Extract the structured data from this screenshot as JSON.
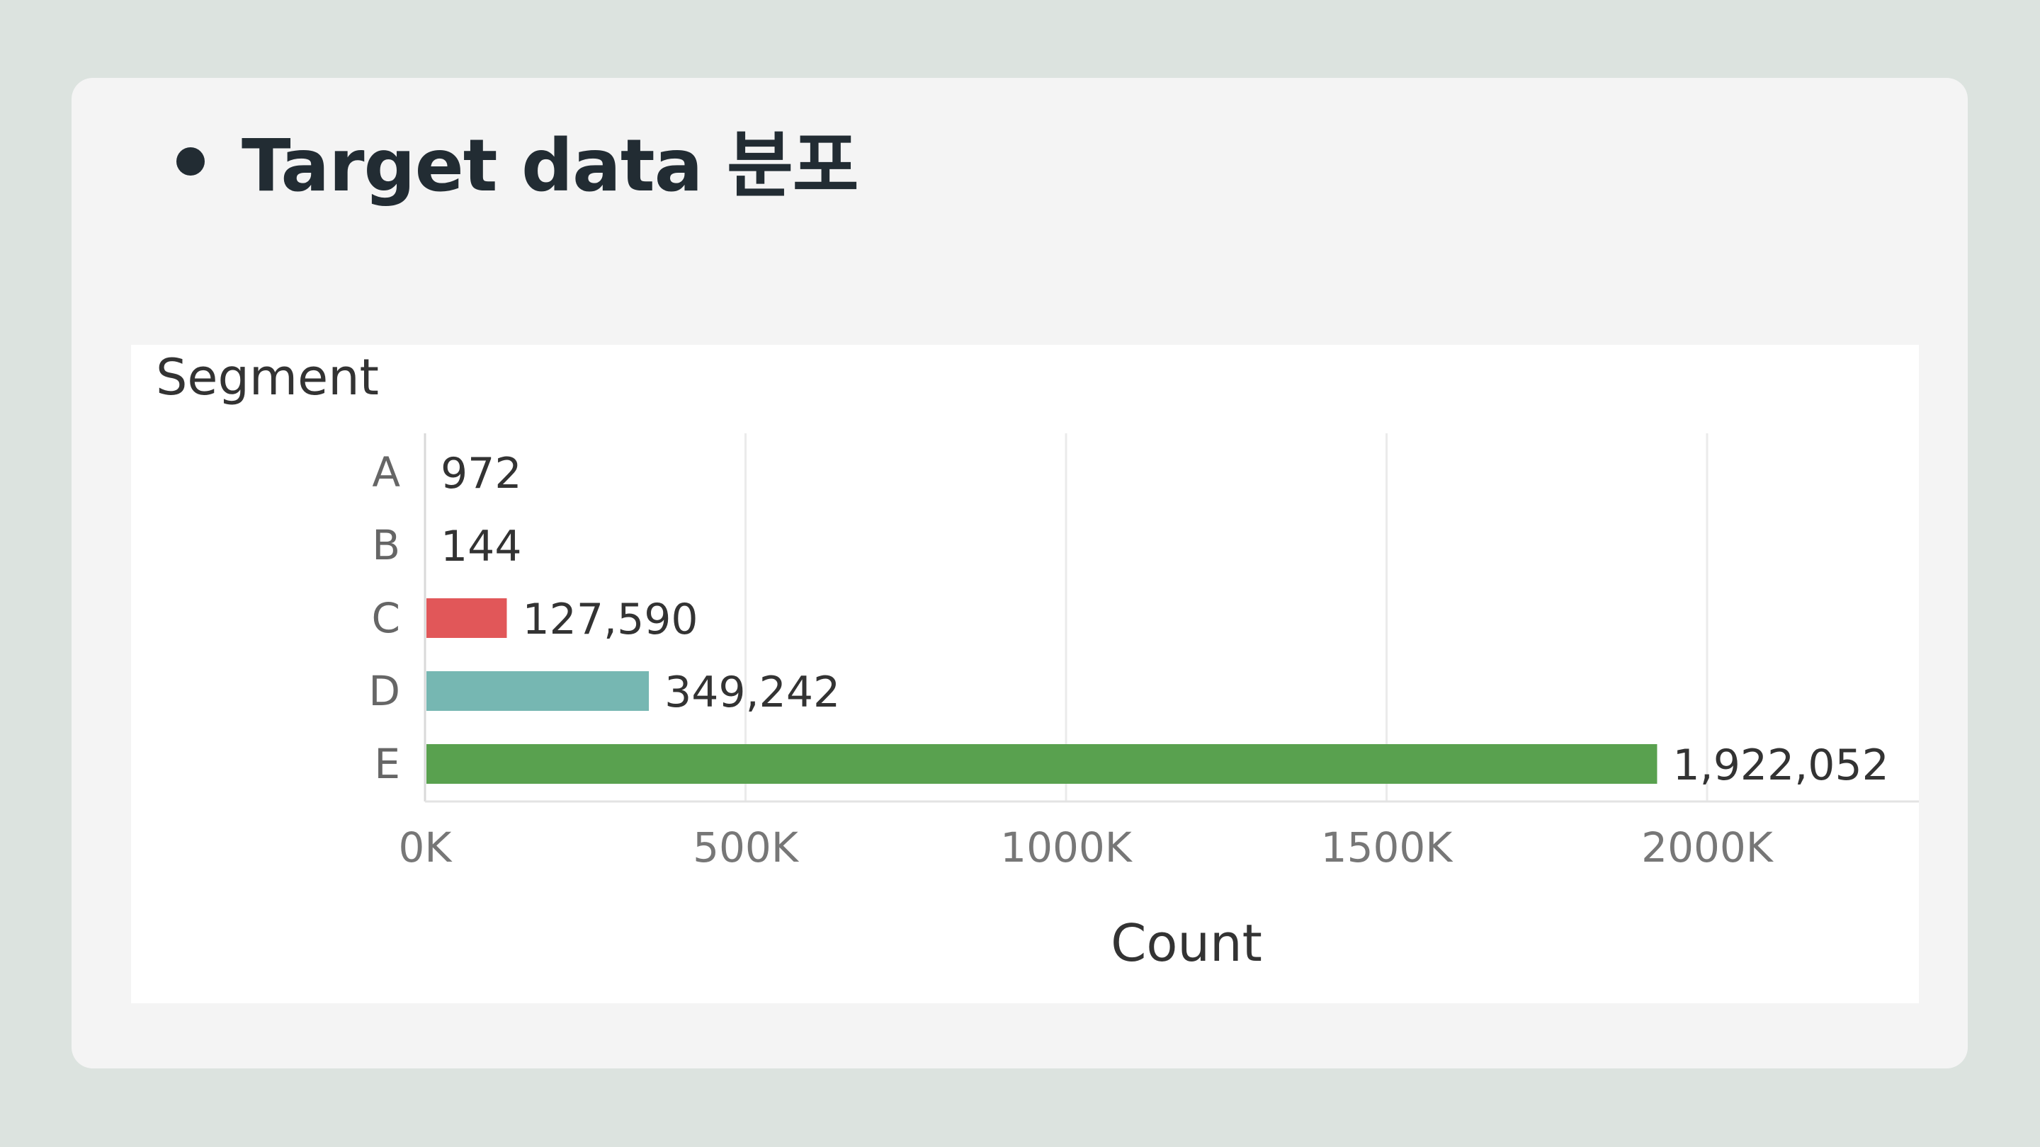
{
  "slide": {
    "title": "Target data 분포"
  },
  "chart_data": {
    "type": "bar",
    "orientation": "horizontal",
    "title": "Segment",
    "xlabel": "Count",
    "ylabel": "",
    "categories": [
      "A",
      "B",
      "C",
      "D",
      "E"
    ],
    "values": [
      972,
      144,
      127590,
      349242,
      1922052
    ],
    "value_labels": [
      "972",
      "144",
      "127,590",
      "349,242",
      "1,922,052"
    ],
    "colors": [
      "#e15759",
      "#e15759",
      "#e15759",
      "#76b7b2",
      "#59a14f"
    ],
    "xlim": [
      0,
      2340000
    ],
    "x_ticks": [
      0,
      500000,
      1000000,
      1500000,
      2000000
    ],
    "x_tick_labels": [
      "0K",
      "500K",
      "1000K",
      "1500K",
      "2000K"
    ],
    "grid": true,
    "legend": "none"
  }
}
